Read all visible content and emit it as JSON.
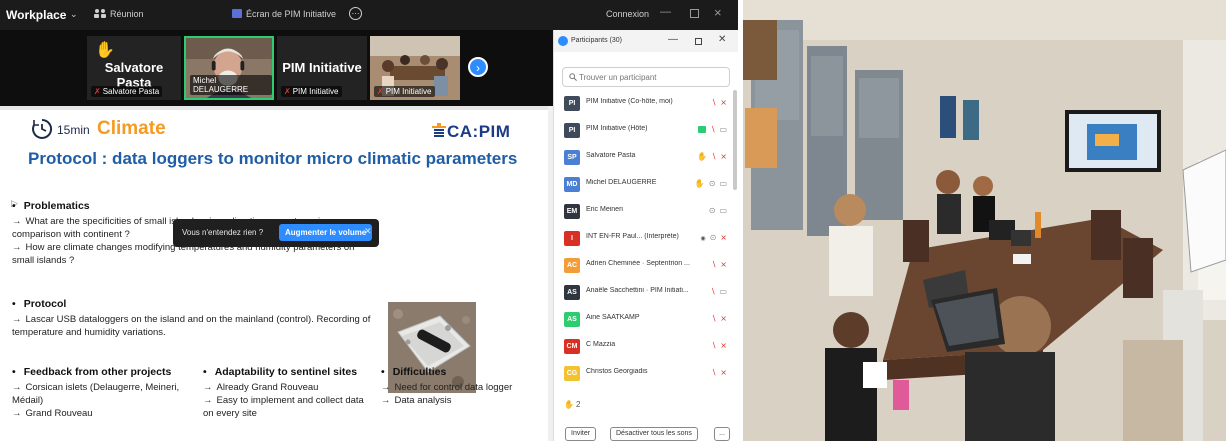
{
  "titlebar": {
    "app_name": "Workplace",
    "meeting_label": "Réunion",
    "screen_share_label": "Écran de PIM Initiative",
    "connection_label": "Connexion"
  },
  "strip": {
    "tiles": [
      {
        "big_name": "Salvatore Pasta",
        "small_name": "Salvatore Pasta",
        "hand_raised": true
      },
      {
        "big_name": "",
        "small_name": "Michel DELAUGERRE",
        "hand_raised": false
      },
      {
        "big_name": "PIM Initiative",
        "small_name": "PIM Initiative",
        "hand_raised": false
      },
      {
        "big_name": "",
        "small_name": "PIM Initiative",
        "hand_raised": false
      }
    ]
  },
  "slide": {
    "time_label": "15min",
    "topic_label": "Climate",
    "brand_label": "CA:PIM",
    "heading": "Protocol : data loggers to monitor micro climatic parameters",
    "sections": {
      "problematics": {
        "title": "Problematics",
        "lines": [
          "What are the specificities of small islands micro-climatic parameteres in comparison with continent ?",
          "How are climate changes modifying temperatures and humidity parameters on small islands ?"
        ]
      },
      "protocol": {
        "title": "Protocol",
        "lines": [
          "Lascar USB dataloggers on the island and on the mainland (control). Recording of temperature and humidity variations."
        ]
      },
      "feedback": {
        "title": "Feedback from other projects",
        "lines": [
          "Corsican islets (Delaugerre, Meineri, Médail)",
          "Grand Rouveau"
        ]
      },
      "adaptability": {
        "title": "Adaptability to sentinel sites",
        "lines": [
          "Already Grand Rouveau",
          "Easy to implement and collect data on every site"
        ]
      },
      "difficulties": {
        "title": "Difficulties",
        "lines": [
          "Need for control data logger",
          "Data analysis"
        ]
      }
    }
  },
  "notification": {
    "message": "Vous n'entendez rien ?",
    "action_label": "Augmenter le volume"
  },
  "participants": {
    "title": "Participants (30)",
    "search_placeholder": "Trouver un participant",
    "rows": [
      {
        "initials": "PI",
        "color": "#3f4a5a",
        "name": "PIM Initiative (Co-hôte, moi)",
        "icons": [
          "mic-off",
          "cam-off"
        ]
      },
      {
        "initials": "PI",
        "color": "#3f4a5a",
        "name": "PIM Initiative (Hôte)",
        "icons": [
          "cc",
          "mic-off",
          "cam"
        ]
      },
      {
        "initials": "SP",
        "color": "#4a7fd4",
        "name": "Salvatore Pasta",
        "icons": [
          "hand",
          "mic-off",
          "cam-off"
        ]
      },
      {
        "initials": "MD",
        "color": "#4a7fd4",
        "name": "Michel DELAUGERRE",
        "icons": [
          "hand",
          "mic",
          "cam"
        ]
      },
      {
        "initials": "EM",
        "color": "#2f3640",
        "name": "Eric Meineri",
        "icons": [
          "mic",
          "cam"
        ]
      },
      {
        "initials": "I",
        "color": "#d93025",
        "name": "INT EN-FR Paul... (Interprète)",
        "icons": [
          "interp",
          "mic",
          "cam-off"
        ]
      },
      {
        "initials": "AC",
        "color": "#f29d38",
        "name": "Adrien Cheminée · Septentrion ...",
        "icons": [
          "mic-off",
          "cam-off"
        ]
      },
      {
        "initials": "AS",
        "color": "#2f3640",
        "name": "Anaële Sacchettini · PIM Initiati...",
        "icons": [
          "mic-off",
          "cam"
        ]
      },
      {
        "initials": "AS",
        "color": "#2ecc71",
        "name": "Aine SAATKAMP",
        "icons": [
          "mic-off",
          "cam-off"
        ]
      },
      {
        "initials": "CM",
        "color": "#d93025",
        "name": "C Mazzia",
        "icons": [
          "mic-off",
          "cam-off"
        ]
      },
      {
        "initials": "CG",
        "color": "#f2c230",
        "name": "Christos Georgiadis",
        "icons": [
          "mic-off",
          "cam-off"
        ]
      }
    ],
    "raised_hands": "2",
    "invite_label": "Inviter",
    "mute_all_label": "Désactiver tous les sons",
    "more_label": "..."
  },
  "colors": {
    "accent_blue": "#2d8cff",
    "slide_heading": "#1f5da8",
    "topic_orange": "#f59a23",
    "brand_navy": "#1c3b84",
    "muted_red": "#e53935"
  }
}
